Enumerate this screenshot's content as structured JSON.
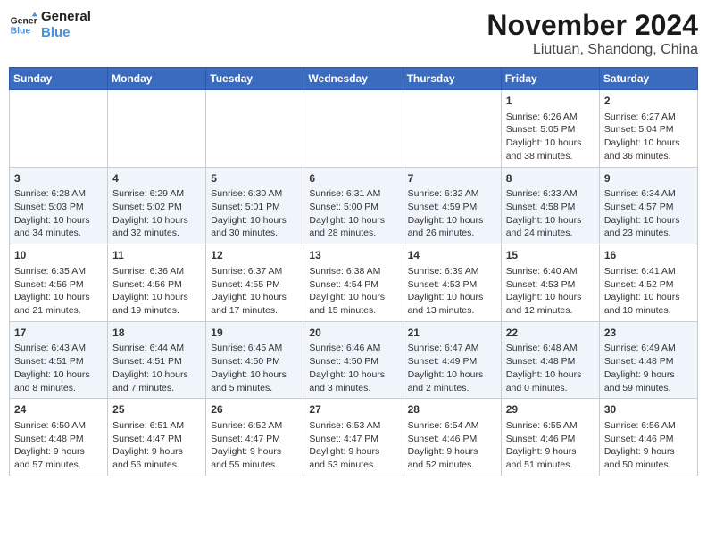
{
  "logo": {
    "line1": "General",
    "line2": "Blue"
  },
  "title": "November 2024",
  "location": "Liutuan, Shandong, China",
  "weekdays": [
    "Sunday",
    "Monday",
    "Tuesday",
    "Wednesday",
    "Thursday",
    "Friday",
    "Saturday"
  ],
  "weeks": [
    [
      {
        "day": "",
        "info": ""
      },
      {
        "day": "",
        "info": ""
      },
      {
        "day": "",
        "info": ""
      },
      {
        "day": "",
        "info": ""
      },
      {
        "day": "",
        "info": ""
      },
      {
        "day": "1",
        "info": "Sunrise: 6:26 AM\nSunset: 5:05 PM\nDaylight: 10 hours\nand 38 minutes."
      },
      {
        "day": "2",
        "info": "Sunrise: 6:27 AM\nSunset: 5:04 PM\nDaylight: 10 hours\nand 36 minutes."
      }
    ],
    [
      {
        "day": "3",
        "info": "Sunrise: 6:28 AM\nSunset: 5:03 PM\nDaylight: 10 hours\nand 34 minutes."
      },
      {
        "day": "4",
        "info": "Sunrise: 6:29 AM\nSunset: 5:02 PM\nDaylight: 10 hours\nand 32 minutes."
      },
      {
        "day": "5",
        "info": "Sunrise: 6:30 AM\nSunset: 5:01 PM\nDaylight: 10 hours\nand 30 minutes."
      },
      {
        "day": "6",
        "info": "Sunrise: 6:31 AM\nSunset: 5:00 PM\nDaylight: 10 hours\nand 28 minutes."
      },
      {
        "day": "7",
        "info": "Sunrise: 6:32 AM\nSunset: 4:59 PM\nDaylight: 10 hours\nand 26 minutes."
      },
      {
        "day": "8",
        "info": "Sunrise: 6:33 AM\nSunset: 4:58 PM\nDaylight: 10 hours\nand 24 minutes."
      },
      {
        "day": "9",
        "info": "Sunrise: 6:34 AM\nSunset: 4:57 PM\nDaylight: 10 hours\nand 23 minutes."
      }
    ],
    [
      {
        "day": "10",
        "info": "Sunrise: 6:35 AM\nSunset: 4:56 PM\nDaylight: 10 hours\nand 21 minutes."
      },
      {
        "day": "11",
        "info": "Sunrise: 6:36 AM\nSunset: 4:56 PM\nDaylight: 10 hours\nand 19 minutes."
      },
      {
        "day": "12",
        "info": "Sunrise: 6:37 AM\nSunset: 4:55 PM\nDaylight: 10 hours\nand 17 minutes."
      },
      {
        "day": "13",
        "info": "Sunrise: 6:38 AM\nSunset: 4:54 PM\nDaylight: 10 hours\nand 15 minutes."
      },
      {
        "day": "14",
        "info": "Sunrise: 6:39 AM\nSunset: 4:53 PM\nDaylight: 10 hours\nand 13 minutes."
      },
      {
        "day": "15",
        "info": "Sunrise: 6:40 AM\nSunset: 4:53 PM\nDaylight: 10 hours\nand 12 minutes."
      },
      {
        "day": "16",
        "info": "Sunrise: 6:41 AM\nSunset: 4:52 PM\nDaylight: 10 hours\nand 10 minutes."
      }
    ],
    [
      {
        "day": "17",
        "info": "Sunrise: 6:43 AM\nSunset: 4:51 PM\nDaylight: 10 hours\nand 8 minutes."
      },
      {
        "day": "18",
        "info": "Sunrise: 6:44 AM\nSunset: 4:51 PM\nDaylight: 10 hours\nand 7 minutes."
      },
      {
        "day": "19",
        "info": "Sunrise: 6:45 AM\nSunset: 4:50 PM\nDaylight: 10 hours\nand 5 minutes."
      },
      {
        "day": "20",
        "info": "Sunrise: 6:46 AM\nSunset: 4:50 PM\nDaylight: 10 hours\nand 3 minutes."
      },
      {
        "day": "21",
        "info": "Sunrise: 6:47 AM\nSunset: 4:49 PM\nDaylight: 10 hours\nand 2 minutes."
      },
      {
        "day": "22",
        "info": "Sunrise: 6:48 AM\nSunset: 4:48 PM\nDaylight: 10 hours\nand 0 minutes."
      },
      {
        "day": "23",
        "info": "Sunrise: 6:49 AM\nSunset: 4:48 PM\nDaylight: 9 hours\nand 59 minutes."
      }
    ],
    [
      {
        "day": "24",
        "info": "Sunrise: 6:50 AM\nSunset: 4:48 PM\nDaylight: 9 hours\nand 57 minutes."
      },
      {
        "day": "25",
        "info": "Sunrise: 6:51 AM\nSunset: 4:47 PM\nDaylight: 9 hours\nand 56 minutes."
      },
      {
        "day": "26",
        "info": "Sunrise: 6:52 AM\nSunset: 4:47 PM\nDaylight: 9 hours\nand 55 minutes."
      },
      {
        "day": "27",
        "info": "Sunrise: 6:53 AM\nSunset: 4:47 PM\nDaylight: 9 hours\nand 53 minutes."
      },
      {
        "day": "28",
        "info": "Sunrise: 6:54 AM\nSunset: 4:46 PM\nDaylight: 9 hours\nand 52 minutes."
      },
      {
        "day": "29",
        "info": "Sunrise: 6:55 AM\nSunset: 4:46 PM\nDaylight: 9 hours\nand 51 minutes."
      },
      {
        "day": "30",
        "info": "Sunrise: 6:56 AM\nSunset: 4:46 PM\nDaylight: 9 hours\nand 50 minutes."
      }
    ]
  ]
}
